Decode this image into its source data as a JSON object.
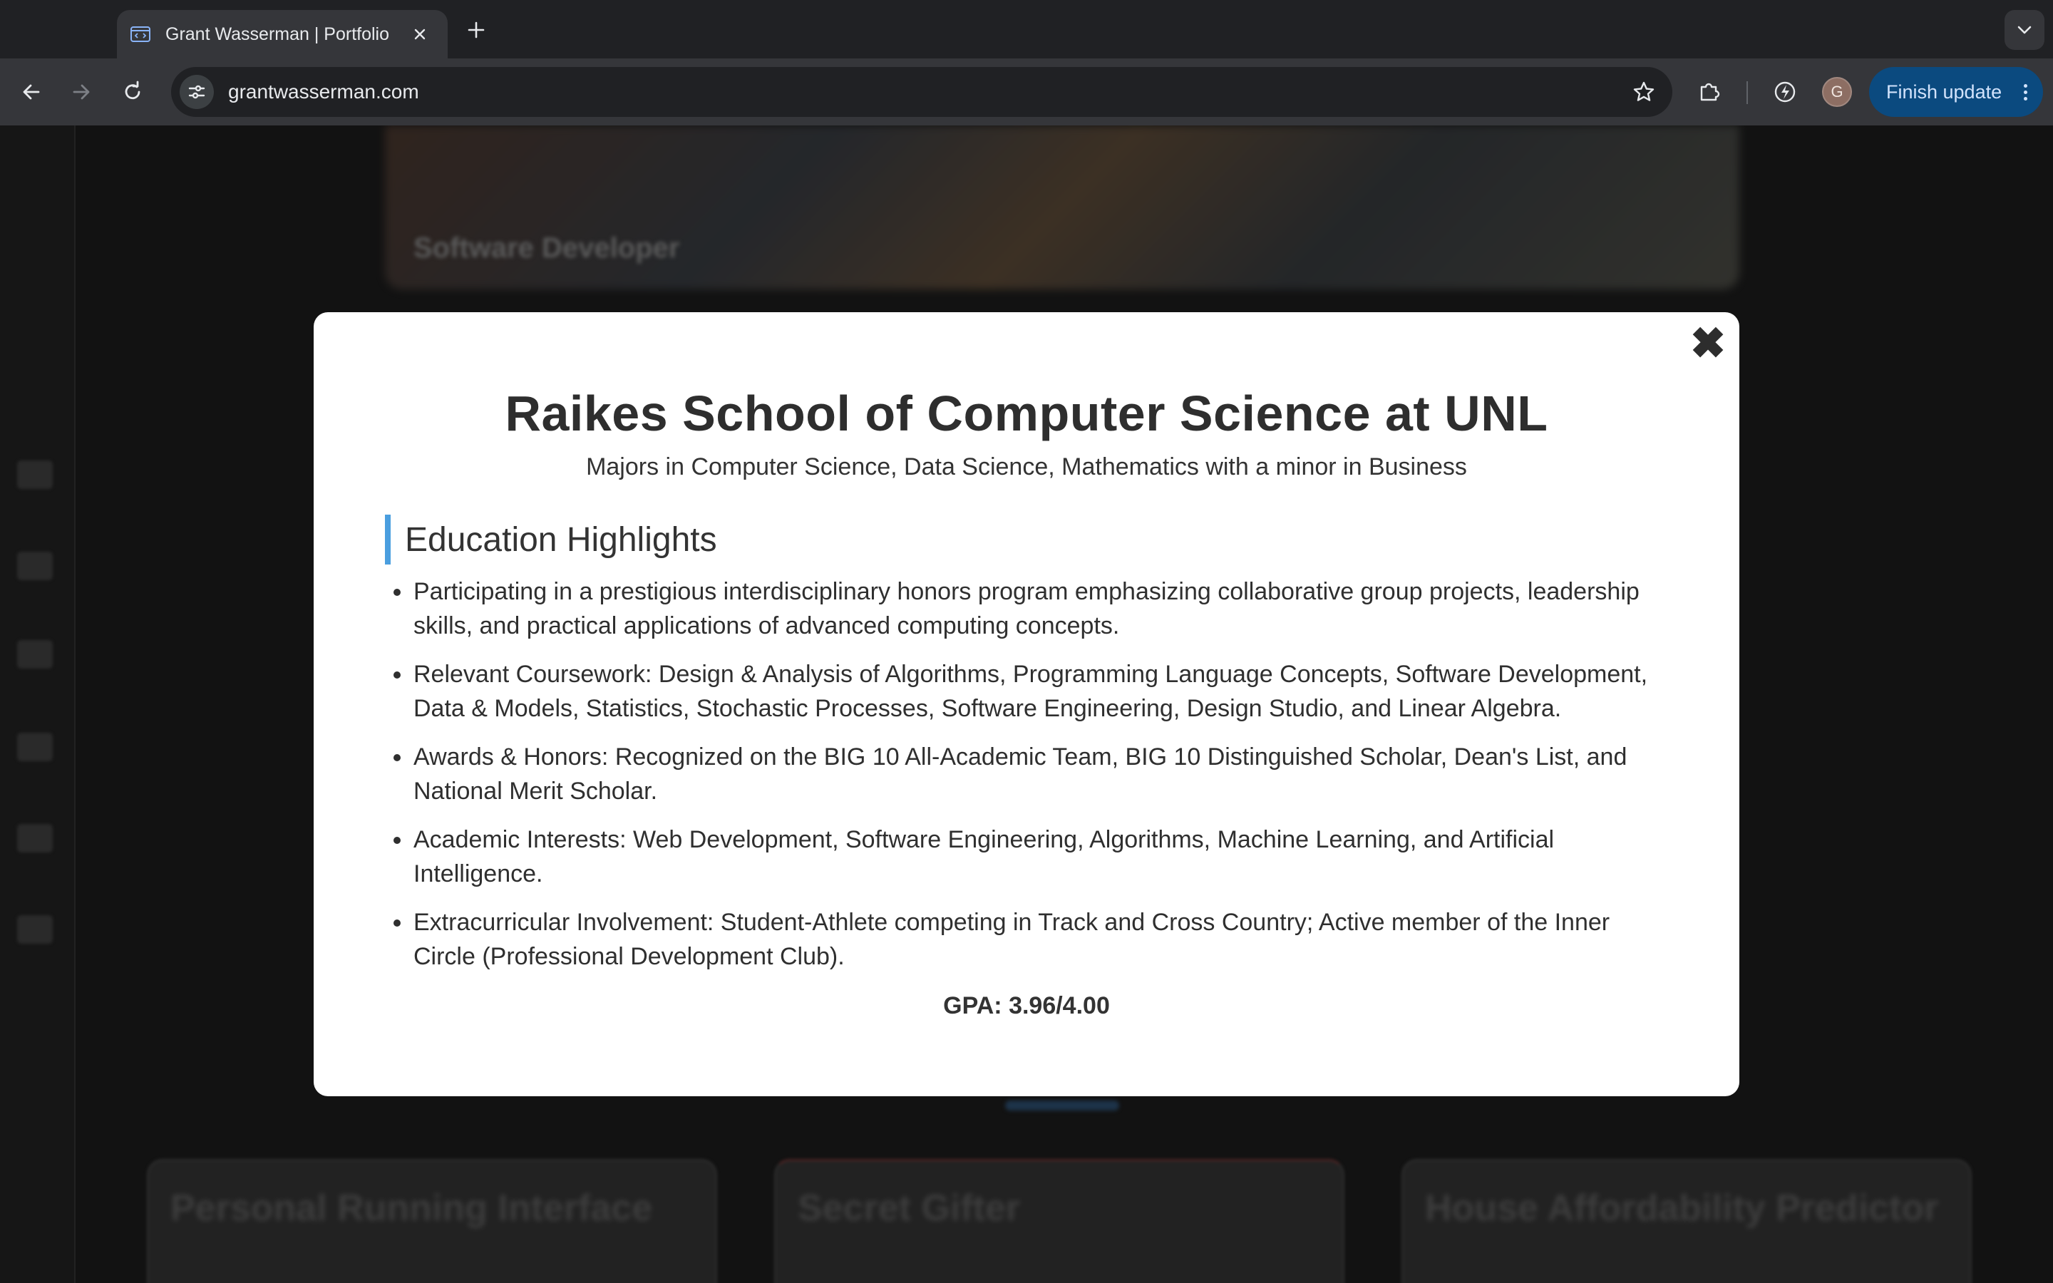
{
  "browser": {
    "tab": {
      "title": "Grant Wasserman | Portfolio"
    },
    "url": "grantwasserman.com",
    "profile_initial": "G",
    "finish_update_label": "Finish update",
    "accent": "#0b4a7f"
  },
  "background": {
    "hero_text": "Software Developer",
    "projects": [
      {
        "title": "Personal Running Interface"
      },
      {
        "title": "Secret Gifter"
      },
      {
        "title": "House Affordability Predictor"
      }
    ]
  },
  "modal": {
    "title": "Raikes School of Computer Science at UNL",
    "subtitle": "Majors in Computer Science, Data Science, Mathematics with a minor in Business",
    "section_heading": "Education Highlights",
    "highlights": [
      "Participating in a prestigious interdisciplinary honors program emphasizing collaborative group projects, leadership skills, and practical applications of advanced computing concepts.",
      "Relevant Coursework: Design & Analysis of Algorithms, Programming Language Concepts, Software Development, Data & Models, Statistics, Stochastic Processes, Software Engineering, Design Studio, and Linear Algebra.",
      "Awards & Honors: Recognized on the BIG 10 All-Academic Team, BIG 10 Distinguished Scholar, Dean's List, and National Merit Scholar.",
      "Academic Interests: Web Development, Software Engineering, Algorithms, Machine Learning, and Artificial Intelligence.",
      "Extracurricular Involvement: Student-Athlete competing in Track and Cross Country; Active member of the Inner Circle (Professional Development Club)."
    ],
    "gpa": "GPA: 3.96/4.00",
    "close_glyph": "✖",
    "accent": "#4a9edf"
  }
}
